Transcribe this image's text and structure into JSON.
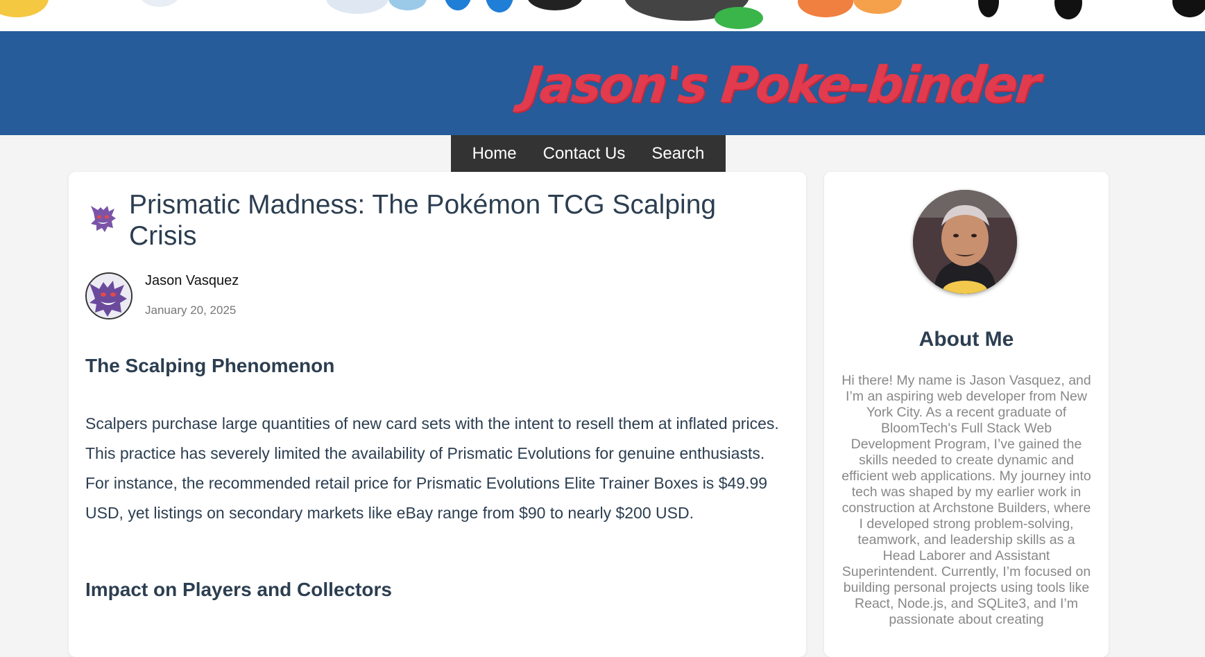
{
  "site": {
    "title": "Jason's Poke-binder"
  },
  "nav": {
    "items": [
      "Home",
      "Contact Us",
      "Search"
    ]
  },
  "post": {
    "title": "Prismatic Madness: The Pokémon TCG Scalping Crisis",
    "author": "Jason Vasquez",
    "date": "January 20, 2025",
    "sections": [
      {
        "heading": "The Scalping Phenomenon",
        "body": "Scalpers purchase large quantities of new card sets with the intent to resell them at inflated prices. This practice has severely limited the availability of Prismatic Evolutions for genuine enthusiasts. For instance, the recommended retail price for Prismatic Evolutions Elite Trainer Boxes is $49.99 USD, yet listings on secondary markets like eBay range from $90 to nearly $200 USD."
      },
      {
        "heading": "Impact on Players and Collectors"
      }
    ]
  },
  "sidebar": {
    "heading": "About Me",
    "bio": "Hi there! My name is Jason Vasquez, and I’m an aspiring web developer from New York City. As a recent graduate of BloomTech's Full Stack Web Development Program, I’ve gained the skills needed to create dynamic and efficient web applications. My journey into tech was shaped by my earlier work in construction at Archstone Builders, where I developed strong problem-solving, teamwork, and leadership skills as a Head Laborer and Assistant Superintendent. Currently, I’m focused on building personal projects using tools like React, Node.js, and SQLite3, and I’m passionate about creating"
  },
  "colors": {
    "header_bg": "#255c99",
    "title_red": "#e23b4e",
    "nav_bg": "#333333",
    "heading_text": "#2c3e50",
    "muted_text": "#888888"
  },
  "icons": {
    "post_icon": "gengar-icon",
    "author_avatar": "gengar-avatar"
  }
}
